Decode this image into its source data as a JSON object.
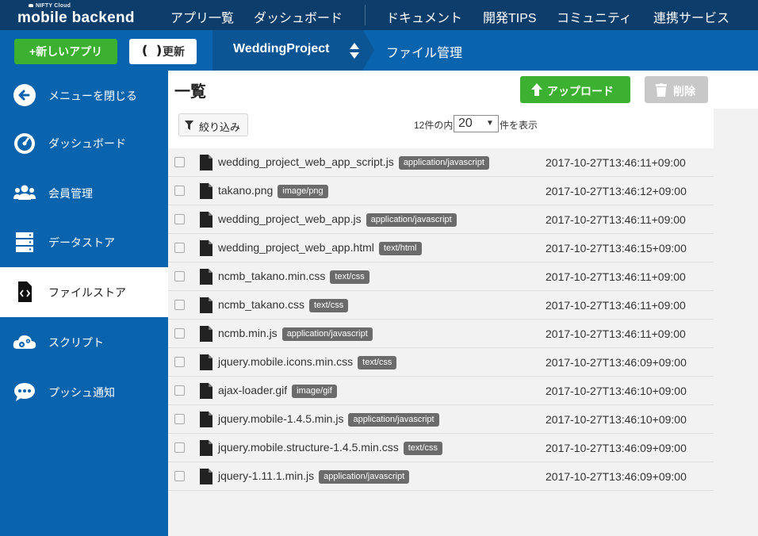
{
  "brand": {
    "small": "NIFTY Cloud",
    "big": "mobile backend"
  },
  "topnav": [
    "アプリ一覧",
    "ダッシュボード",
    "ドキュメント",
    "開発TIPS",
    "コミュニティ",
    "連携サービス"
  ],
  "subbar": {
    "new_app": "+新しいアプリ",
    "refresh": "更新",
    "project": "WeddingProject",
    "breadcrumb": "ファイル管理"
  },
  "sidebar": [
    {
      "label": "メニューを閉じる",
      "icon": "arrow-left-icon"
    },
    {
      "label": "ダッシュボード",
      "icon": "gauge-icon"
    },
    {
      "label": "会員管理",
      "icon": "users-icon"
    },
    {
      "label": "データストア",
      "icon": "database-icon"
    },
    {
      "label": "ファイルストア",
      "icon": "file-code-icon",
      "active": true
    },
    {
      "label": "スクリプト",
      "icon": "cloud-gear-icon"
    },
    {
      "label": "プッシュ通知",
      "icon": "chat-bubble-icon"
    }
  ],
  "main": {
    "title": "一覧",
    "upload": "アップロード",
    "delete": "削除",
    "filter": "絞り込み",
    "count_prefix": "12件の内",
    "per_page": "20",
    "count_suffix": "件を表示"
  },
  "files": [
    {
      "name": "wedding_project_web_app_script.js",
      "type": "application/javascript",
      "date": "2017-10-27T13:46:11+09:00"
    },
    {
      "name": "takano.png",
      "type": "image/png",
      "date": "2017-10-27T13:46:12+09:00"
    },
    {
      "name": "wedding_project_web_app.js",
      "type": "application/javascript",
      "date": "2017-10-27T13:46:11+09:00"
    },
    {
      "name": "wedding_project_web_app.html",
      "type": "text/html",
      "date": "2017-10-27T13:46:15+09:00"
    },
    {
      "name": "ncmb_takano.min.css",
      "type": "text/css",
      "date": "2017-10-27T13:46:11+09:00"
    },
    {
      "name": "ncmb_takano.css",
      "type": "text/css",
      "date": "2017-10-27T13:46:11+09:00"
    },
    {
      "name": "ncmb.min.js",
      "type": "application/javascript",
      "date": "2017-10-27T13:46:11+09:00"
    },
    {
      "name": "jquery.mobile.icons.min.css",
      "type": "text/css",
      "date": "2017-10-27T13:46:09+09:00"
    },
    {
      "name": "ajax-loader.gif",
      "type": "image/gif",
      "date": "2017-10-27T13:46:10+09:00"
    },
    {
      "name": "jquery.mobile-1.4.5.min.js",
      "type": "application/javascript",
      "date": "2017-10-27T13:46:10+09:00"
    },
    {
      "name": "jquery.mobile.structure-1.4.5.min.css",
      "type": "text/css",
      "date": "2017-10-27T13:46:09+09:00"
    },
    {
      "name": "jquery-1.11.1.min.js",
      "type": "application/javascript",
      "date": "2017-10-27T13:46:09+09:00"
    }
  ],
  "colors": {
    "nav_dark": "#0c3d6b",
    "brand_blue": "#0a64ad",
    "green": "#3cb030",
    "badge": "#6b6b6b"
  }
}
